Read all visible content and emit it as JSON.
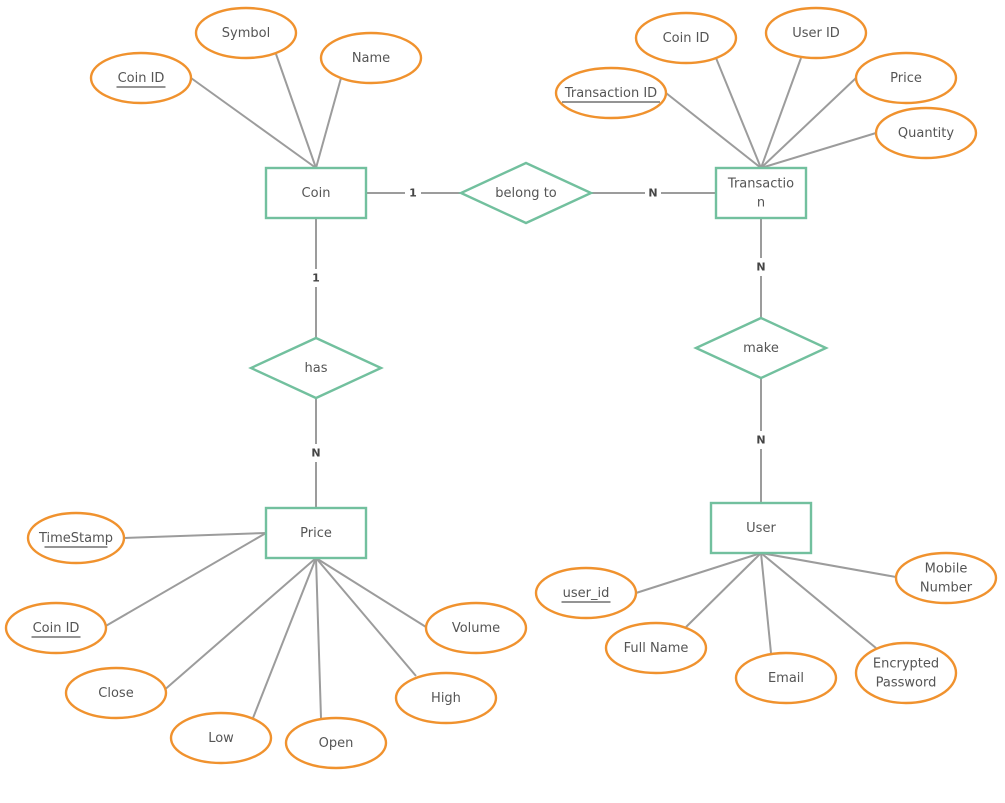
{
  "diagram": {
    "type": "er-diagram",
    "colors": {
      "entity_stroke": "#72c09e",
      "attribute_stroke": "#f0922e",
      "connector": "#9c9c9c",
      "text": "#555555"
    },
    "entities": [
      {
        "id": "coin",
        "label": "Coin"
      },
      {
        "id": "transaction",
        "label": "Transactio\nn"
      },
      {
        "id": "price",
        "label": "Price"
      },
      {
        "id": "user",
        "label": "User"
      }
    ],
    "relationships": [
      {
        "id": "belong_to",
        "label": "belong to",
        "from": "coin",
        "to": "transaction",
        "from_card": "1",
        "to_card": "N"
      },
      {
        "id": "has",
        "label": "has",
        "from": "coin",
        "to": "price",
        "from_card": "1",
        "to_card": "N"
      },
      {
        "id": "make",
        "label": "make",
        "from": "transaction",
        "to": "user",
        "from_card": "N",
        "to_card": "N"
      }
    ],
    "attributes": [
      {
        "entity": "coin",
        "label": "Coin ID",
        "key": true
      },
      {
        "entity": "coin",
        "label": "Symbol",
        "key": false
      },
      {
        "entity": "coin",
        "label": "Name",
        "key": false
      },
      {
        "entity": "transaction",
        "label": "Transaction ID",
        "key": true
      },
      {
        "entity": "transaction",
        "label": "Coin ID",
        "key": false
      },
      {
        "entity": "transaction",
        "label": "User ID",
        "key": false
      },
      {
        "entity": "transaction",
        "label": "Price",
        "key": false
      },
      {
        "entity": "transaction",
        "label": "Quantity",
        "key": false
      },
      {
        "entity": "price",
        "label": "TimeStamp",
        "key": true
      },
      {
        "entity": "price",
        "label": "Coin ID",
        "key": true
      },
      {
        "entity": "price",
        "label": "Close",
        "key": false
      },
      {
        "entity": "price",
        "label": "Low",
        "key": false
      },
      {
        "entity": "price",
        "label": "Open",
        "key": false
      },
      {
        "entity": "price",
        "label": "High",
        "key": false
      },
      {
        "entity": "price",
        "label": "Volume",
        "key": false
      },
      {
        "entity": "user",
        "label": "user_id",
        "key": true
      },
      {
        "entity": "user",
        "label": "Full Name",
        "key": false
      },
      {
        "entity": "user",
        "label": "Email",
        "key": false
      },
      {
        "entity": "user",
        "label": "Encrypted\nPassword",
        "key": false
      },
      {
        "entity": "user",
        "label": "Mobile\nNumber",
        "key": false
      }
    ]
  }
}
